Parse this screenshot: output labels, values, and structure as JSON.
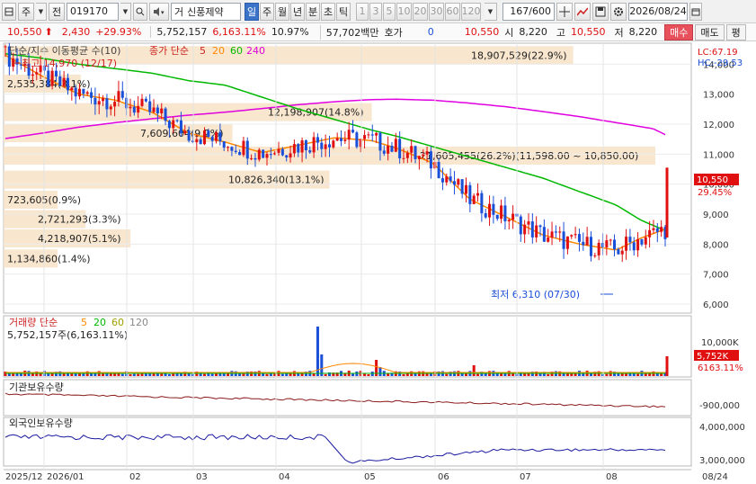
{
  "toolbar": {
    "mode_label": "주",
    "prev_label": "전",
    "stock_code": "019170",
    "search_icon": "magnifier-icon",
    "stock_name": "신풍제약",
    "stock_prefix": "거",
    "period_tabs": [
      "일",
      "주",
      "월",
      "년",
      "분",
      "초",
      "틱"
    ],
    "active_period": "일",
    "minute_options": [
      "1",
      "3",
      "5",
      "10",
      "20",
      "30",
      "60",
      "120"
    ],
    "page_count": "167",
    "page_total": "/600",
    "date": "2026/08/24"
  },
  "quote": {
    "price": "10,550",
    "change": "2,430",
    "change_pct": "+29.93%",
    "volume": "5,752,157",
    "volume_pct": "6,163.11%",
    "turnover": "10.97%",
    "amount": "57,702백만",
    "hoga_label": "호가",
    "hoga_value": "0",
    "hoga_price": "10,550",
    "open_label": "시",
    "open": "8,220",
    "high_label": "고",
    "high": "10,550",
    "low_label": "저",
    "low": "8,220",
    "buy_label": "매수",
    "sell_label": "매도",
    "extra_label": "평"
  },
  "price_panel": {
    "title": "단순/지수 이동평균 수(10)",
    "legend_title": "종가 단순",
    "legend_periods": [
      "5",
      "20",
      "60",
      "240"
    ],
    "legend_colors": [
      "#ff8800",
      "#00b800",
      "#e000e0"
    ],
    "lc_label": "LC:67.19",
    "hc_label": "HC:-29.53",
    "high_marker": "최고 14,970 (12/17)",
    "low_marker": "최저 6,310 (07/30)",
    "current_price_tag": "10,550",
    "current_pct_tag": "29.45%",
    "y_ticks": [
      "14,000",
      "13,000",
      "12,000",
      "11,000",
      "10,000",
      "9,000",
      "8,000",
      "7,000",
      "6,000"
    ],
    "volume_profile": [
      {
        "label": "18,907,529(22.9%)",
        "price": 14300
      },
      {
        "label": "2,535,384(3.1%)",
        "price": 13350
      },
      {
        "label": "12,198,907(14.8%)",
        "price": 12400
      },
      {
        "label": "7,609,604(9.2%)",
        "price": 11700
      },
      {
        "label": "21,605,455(26.2%)(11,598.00 ~ 10,850.00)",
        "price": 10950
      },
      {
        "label": "10,826,340(13.1%)",
        "price": 10150
      },
      {
        "label": "723,605(0.9%)",
        "price": 9480
      },
      {
        "label": "2,721,293(3.3%)",
        "price": 8830
      },
      {
        "label": "4,218,907(5.1%)",
        "price": 8190
      },
      {
        "label": "1,134,860(1.4%)",
        "price": 7520
      }
    ],
    "ma60": [
      [
        0,
        11520
      ],
      [
        15,
        11700
      ],
      [
        30,
        11900
      ],
      [
        45,
        12050
      ],
      [
        60,
        12180
      ],
      [
        75,
        12300
      ],
      [
        90,
        12400
      ],
      [
        105,
        12520
      ],
      [
        120,
        12650
      ],
      [
        135,
        12750
      ],
      [
        150,
        12820
      ],
      [
        160,
        12830
      ],
      [
        175,
        12800
      ],
      [
        190,
        12700
      ],
      [
        205,
        12580
      ],
      [
        220,
        12420
      ],
      [
        235,
        12250
      ],
      [
        250,
        12050
      ],
      [
        265,
        11850
      ],
      [
        270,
        11650
      ]
    ],
    "ma20": [
      [
        0,
        14350
      ],
      [
        15,
        14200
      ],
      [
        30,
        14000
      ],
      [
        45,
        13850
      ],
      [
        60,
        13700
      ],
      [
        75,
        13450
      ],
      [
        90,
        13300
      ],
      [
        105,
        12900
      ],
      [
        120,
        12500
      ],
      [
        135,
        12150
      ],
      [
        150,
        11800
      ],
      [
        160,
        11600
      ],
      [
        175,
        11250
      ],
      [
        190,
        10900
      ],
      [
        205,
        10550
      ],
      [
        220,
        10200
      ],
      [
        235,
        9750
      ],
      [
        250,
        9300
      ],
      [
        260,
        8800
      ],
      [
        270,
        8450
      ]
    ],
    "ma5": [
      [
        0,
        14300
      ],
      [
        15,
        13600
      ],
      [
        30,
        13000
      ],
      [
        45,
        12800
      ],
      [
        60,
        12400
      ],
      [
        75,
        11700
      ],
      [
        90,
        11400
      ],
      [
        105,
        11050
      ],
      [
        120,
        11300
      ],
      [
        135,
        11550
      ],
      [
        150,
        11450
      ],
      [
        160,
        11200
      ],
      [
        175,
        10700
      ],
      [
        190,
        9500
      ],
      [
        205,
        8900
      ],
      [
        220,
        8300
      ],
      [
        235,
        8000
      ],
      [
        250,
        7800
      ],
      [
        260,
        8200
      ],
      [
        270,
        8500
      ]
    ]
  },
  "volume_panel": {
    "title": "거래량 단순",
    "legend_periods": [
      "5",
      "20",
      "60",
      "120"
    ],
    "legend_colors": [
      "#ff8800",
      "#00b800",
      "#a0a000",
      "#888888"
    ],
    "summary": "5,752,157주(6,163.11%)",
    "y_tick": "10,000K",
    "current_tag": "5,752K",
    "current_pct": "6163.11%"
  },
  "inst_panel": {
    "title": "기관보유수량",
    "y_tick": "-900,000"
  },
  "foreign_panel": {
    "title": "외국인보유수량",
    "y_ticks": [
      "4,000,000",
      "3,000,000"
    ]
  },
  "x_axis": {
    "labels": [
      "2025/12",
      "2026/01",
      "02",
      "03",
      "04",
      "05",
      "06",
      "07",
      "08",
      "08/24"
    ]
  },
  "colors": {
    "up": "#e01010",
    "down": "#1a4fd8",
    "ma5": "#ff8800",
    "ma20": "#00b800",
    "ma60": "#e000e0",
    "profile": "#f7e3c9"
  }
}
